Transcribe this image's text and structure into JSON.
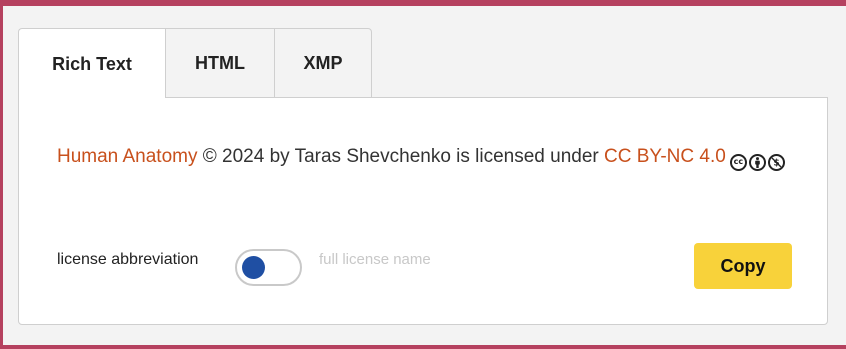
{
  "tabs": [
    {
      "label": "Rich Text",
      "active": true
    },
    {
      "label": "HTML",
      "active": false
    },
    {
      "label": "XMP",
      "active": false
    }
  ],
  "attribution": {
    "work_title": "Human Anatomy",
    "middle_text": " © 2024 by Taras Shevchenko is licensed under ",
    "license_link": "CC BY-NC 4.0",
    "cc_icons": [
      "cc-icon",
      "by-icon",
      "nc-icon"
    ]
  },
  "controls": {
    "left_label": "license abbreviation",
    "right_label": "full license name",
    "toggle_state": "abbreviation",
    "copy_label": "Copy"
  },
  "colors": {
    "accent_border": "#b5415f",
    "link": "#c8501c",
    "copy_button": "#f8d23a",
    "toggle_knob": "#1f4fa3"
  }
}
